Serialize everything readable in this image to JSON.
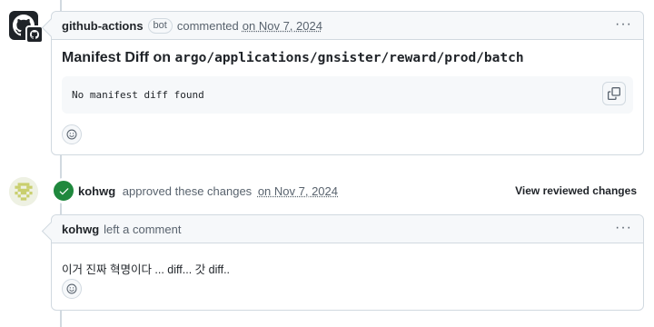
{
  "comment1": {
    "author": "github-actions",
    "badge": "bot",
    "action": "commented",
    "date": "on Nov 7, 2024",
    "title_prefix": "Manifest Diff on",
    "title_path": "argo/applications/gnsister/reward/prod/batch",
    "code": "No manifest diff found",
    "more": "···"
  },
  "review": {
    "author": "kohwg",
    "action": "approved these changes",
    "date": "on Nov 7, 2024",
    "view_link": "View reviewed changes"
  },
  "comment2": {
    "author": "kohwg",
    "action": "left a comment",
    "body": "이거 진짜 혁명이다 ... diff... 갓 diff..",
    "more": "···"
  },
  "colors": {
    "approved": "#1f883d",
    "border": "#d1d9e0",
    "header_bg": "#f6f8fa"
  },
  "icons": {
    "github_avatar": "github-mark-icon",
    "copy": "copy-icon",
    "emoji": "smiley-icon",
    "check": "check-icon",
    "more": "kebab-horizontal-icon"
  }
}
